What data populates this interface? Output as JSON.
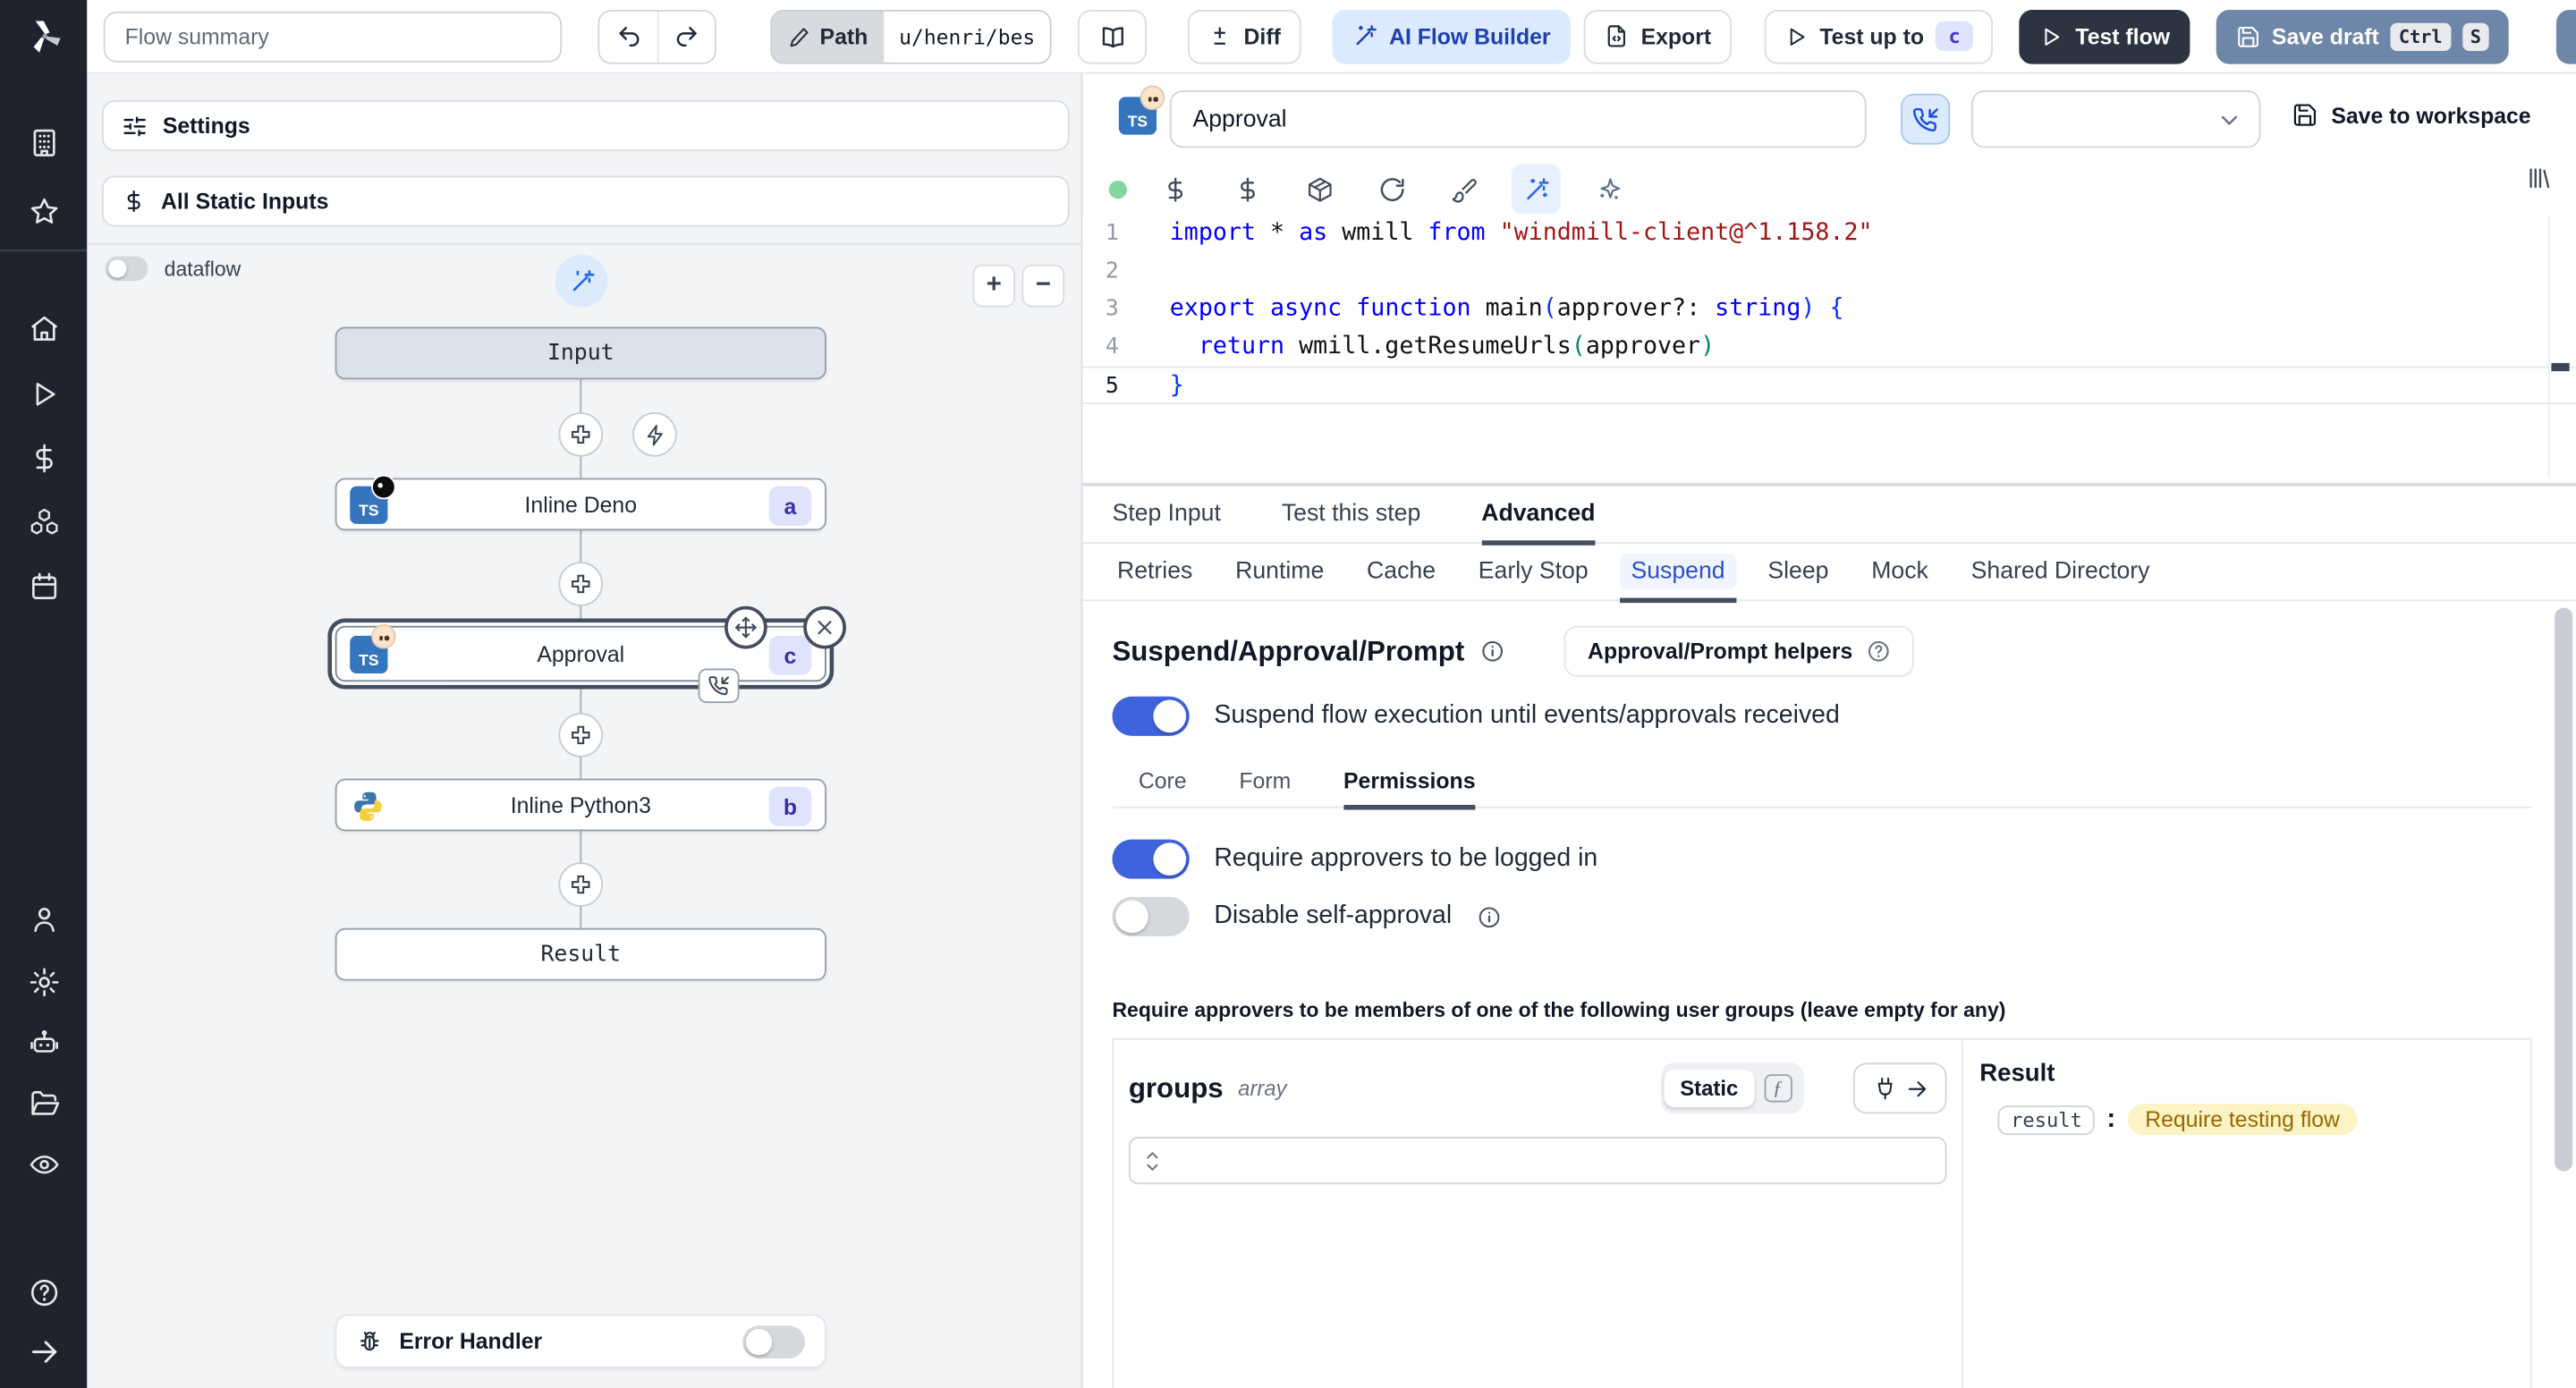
{
  "colors": {
    "accent_blue": "#2563eb",
    "toggle_on": "#3e63dd",
    "ai_button_bg": "#dbeafe",
    "save_draft_bg": "#6e87a8",
    "test_flow_bg": "#2b3440",
    "node_badge_bg": "#dfe3fb",
    "node_badge_text": "#3730a3",
    "result_pill_bg": "#fcf4c4",
    "result_pill_text": "#9a6700",
    "sidebar_bg": "#1e232e"
  },
  "topbar": {
    "flow_summary_placeholder": "Flow summary",
    "path": {
      "label": "Path",
      "value": "u/henri/bes"
    },
    "diff_label": "Diff",
    "ai_flow_builder_label": "AI Flow Builder",
    "export_label": "Export",
    "test_up_to": {
      "label": "Test up to",
      "badge": "c"
    },
    "test_flow_label": "Test flow",
    "save_draft": {
      "label": "Save draft",
      "key1": "Ctrl",
      "key2": "S"
    }
  },
  "sidebar": {
    "icons": [
      "building",
      "star",
      "home",
      "play",
      "dollar",
      "boxes",
      "calendar",
      "user",
      "settings",
      "robot",
      "folder",
      "eye",
      "help",
      "arrow-right"
    ]
  },
  "flow_panel": {
    "settings_label": "Settings",
    "all_static_inputs_label": "All Static Inputs",
    "dataflow_label": "dataflow",
    "nodes": {
      "input": {
        "label": "Input"
      },
      "inline_deno": {
        "label": "Inline Deno",
        "badge": "a"
      },
      "approval": {
        "label": "Approval",
        "badge": "c"
      },
      "inline_python": {
        "label": "Inline Python3",
        "badge": "b"
      },
      "result": {
        "label": "Result"
      }
    },
    "error_handler_label": "Error Handler"
  },
  "editor": {
    "script_name": "Approval",
    "save_to_workspace_label": "Save to workspace",
    "code": {
      "lines": [
        {
          "num": "1",
          "tokens": [
            {
              "t": "import",
              "c": "kw"
            },
            {
              "t": " * ",
              "c": "pl"
            },
            {
              "t": "as",
              "c": "kw"
            },
            {
              "t": " wmill ",
              "c": "pl"
            },
            {
              "t": "from",
              "c": "kw"
            },
            {
              "t": " ",
              "c": "pl"
            },
            {
              "t": "\"windmill-client@^1.158.2\"",
              "c": "str"
            }
          ]
        },
        {
          "num": "2",
          "tokens": []
        },
        {
          "num": "3",
          "tokens": [
            {
              "t": "export",
              "c": "kw"
            },
            {
              "t": " ",
              "c": "pl"
            },
            {
              "t": "async",
              "c": "kw"
            },
            {
              "t": " ",
              "c": "pl"
            },
            {
              "t": "function",
              "c": "kw"
            },
            {
              "t": " main",
              "c": "pl"
            },
            {
              "t": "(",
              "c": "p1"
            },
            {
              "t": "approver",
              "c": "pl"
            },
            {
              "t": "?: ",
              "c": "pl"
            },
            {
              "t": "string",
              "c": "kw"
            },
            {
              "t": ")",
              "c": "p1"
            },
            {
              "t": " {",
              "c": "p1"
            }
          ]
        },
        {
          "num": "4",
          "tokens": [
            {
              "t": "  ",
              "c": "pl"
            },
            {
              "t": "return",
              "c": "kw"
            },
            {
              "t": " wmill.getResumeUrls",
              "c": "pl"
            },
            {
              "t": "(",
              "c": "p2"
            },
            {
              "t": "approver",
              "c": "pl"
            },
            {
              "t": ")",
              "c": "p2"
            }
          ]
        },
        {
          "num": "5",
          "tokens": [
            {
              "t": "}",
              "c": "p1"
            }
          ],
          "active": true
        }
      ]
    }
  },
  "tabs": {
    "main": [
      {
        "label": "Step Input"
      },
      {
        "label": "Test this step"
      },
      {
        "label": "Advanced"
      }
    ],
    "advanced": [
      {
        "label": "Retries"
      },
      {
        "label": "Runtime"
      },
      {
        "label": "Cache"
      },
      {
        "label": "Early Stop"
      },
      {
        "label": "Suspend"
      },
      {
        "label": "Sleep"
      },
      {
        "label": "Mock"
      },
      {
        "label": "Shared Directory"
      }
    ]
  },
  "suspend_section": {
    "heading": "Suspend/Approval/Prompt",
    "helpers_button_label": "Approval/Prompt helpers",
    "suspend_toggle_label": "Suspend flow execution until events/approvals received",
    "tabs": [
      {
        "label": "Core"
      },
      {
        "label": "Form"
      },
      {
        "label": "Permissions"
      }
    ],
    "require_login_label": "Require approvers to be logged in",
    "disable_self_approval_label": "Disable self-approval",
    "groups_note": "Require approvers to be members of one of the following user groups (leave empty for any)",
    "groups_field": {
      "name": "groups",
      "type": "array",
      "static_label": "Static",
      "fn_label": "ƒ"
    },
    "result_panel": {
      "heading": "Result",
      "key": "result",
      "value": "Require testing flow"
    }
  }
}
